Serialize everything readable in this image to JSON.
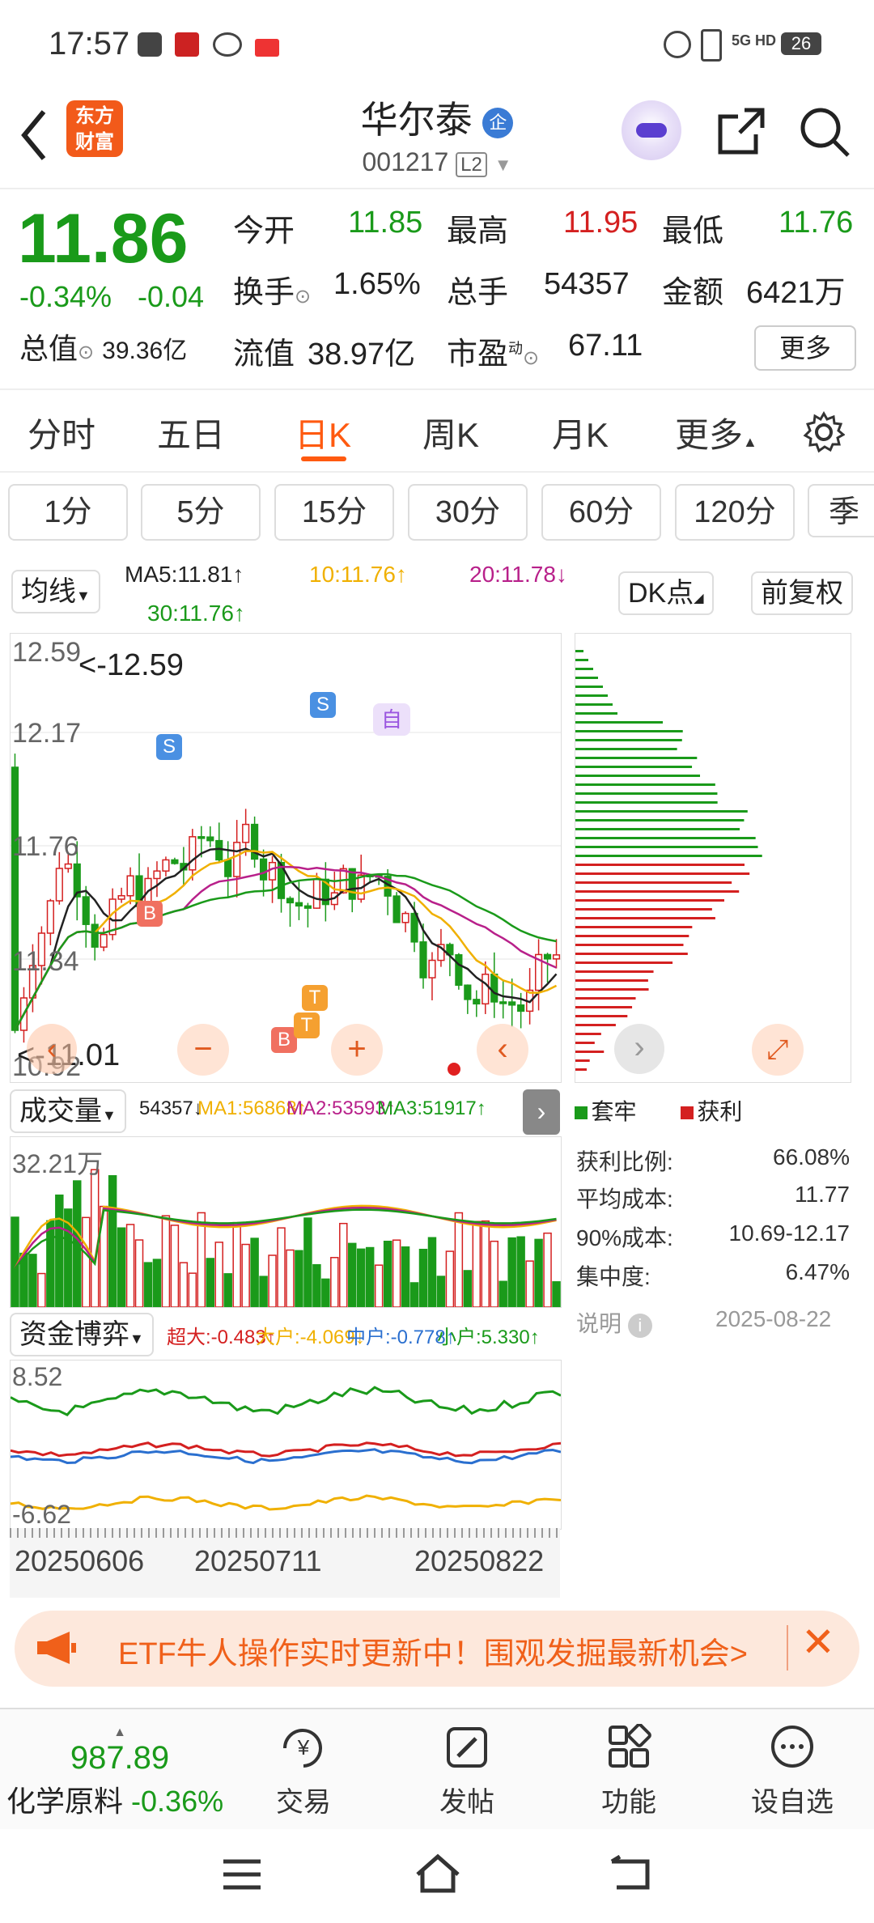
{
  "status": {
    "time": "17:57",
    "battery": "26",
    "net": "5G HD"
  },
  "header": {
    "logo_line1": "东方",
    "logo_line2": "财富",
    "title": "华尔泰",
    "badge": "企",
    "code": "001217",
    "level": "L2"
  },
  "quote": {
    "price": "11.86",
    "change_pct": "-0.34%",
    "change": "-0.04",
    "open_label": "今开",
    "open": "11.85",
    "high_label": "最高",
    "high": "11.95",
    "low_label": "最低",
    "low": "11.76",
    "turnover_label": "换手",
    "turnover": "1.65%",
    "volume_label": "总手",
    "volume": "54357",
    "amount_label": "金额",
    "amount": "6421万",
    "mktcap_label": "总值",
    "mktcap": "39.36亿",
    "float_label": "流值",
    "float": "38.97亿",
    "pe_label": "市盈",
    "pe_sup": "动",
    "pe": "67.11",
    "more_label": "更多"
  },
  "tabs": [
    "分时",
    "五日",
    "日K",
    "周K",
    "月K",
    "更多"
  ],
  "active_tab": "日K",
  "periods": [
    "1分",
    "5分",
    "15分",
    "30分",
    "60分",
    "120分",
    "季"
  ],
  "ma": {
    "selector": "均线",
    "ma5": "MA5:11.81",
    "ma10": "10:11.76",
    "ma20": "20:11.78",
    "ma30": "30:11.76",
    "dk": "DK点",
    "adjust": "前复权"
  },
  "kline": {
    "ymax": "12.59",
    "y2": "12.17",
    "y3": "11.76",
    "y4": "11.34",
    "ymin": "10.92",
    "hi_note": "<-12.59",
    "lo_note": "<-11.01",
    "markers": [
      "S",
      "S",
      "自",
      "B",
      "B",
      "T",
      "T"
    ]
  },
  "volume": {
    "selector": "成交量",
    "vol": "54357",
    "ma1": "MA1:56868",
    "ma2": "MA2:53593",
    "ma3": "MA3:51917",
    "ymax": "32.21万"
  },
  "funds": {
    "selector": "资金博弈",
    "super": "超大:-0.483",
    "big": "大户:-4.069",
    "mid": "中户:-0.778",
    "small": "小户:5.330",
    "ymax": "8.52",
    "ymin": "-6.62"
  },
  "dates": [
    "20250606",
    "20250711",
    "20250822"
  ],
  "chip": {
    "legend_trapped": "套牢",
    "legend_profit": "获利",
    "rows": [
      {
        "label": "获利比例:",
        "value": "66.08%"
      },
      {
        "label": "平均成本:",
        "value": "11.77"
      },
      {
        "label": "90%成本:",
        "value": "10.69-12.17"
      },
      {
        "label": "集中度:",
        "value": "6.47%"
      }
    ],
    "note": "说明",
    "date": "2025-08-22"
  },
  "banner": {
    "text": "ETF牛人操作实时更新中！围观发掘最新机会>"
  },
  "bottom": {
    "index_value": "987.89",
    "index_name": "化学原料",
    "index_change": "-0.36%",
    "buttons": [
      "交易",
      "发帖",
      "功能",
      "设自选"
    ]
  }
}
